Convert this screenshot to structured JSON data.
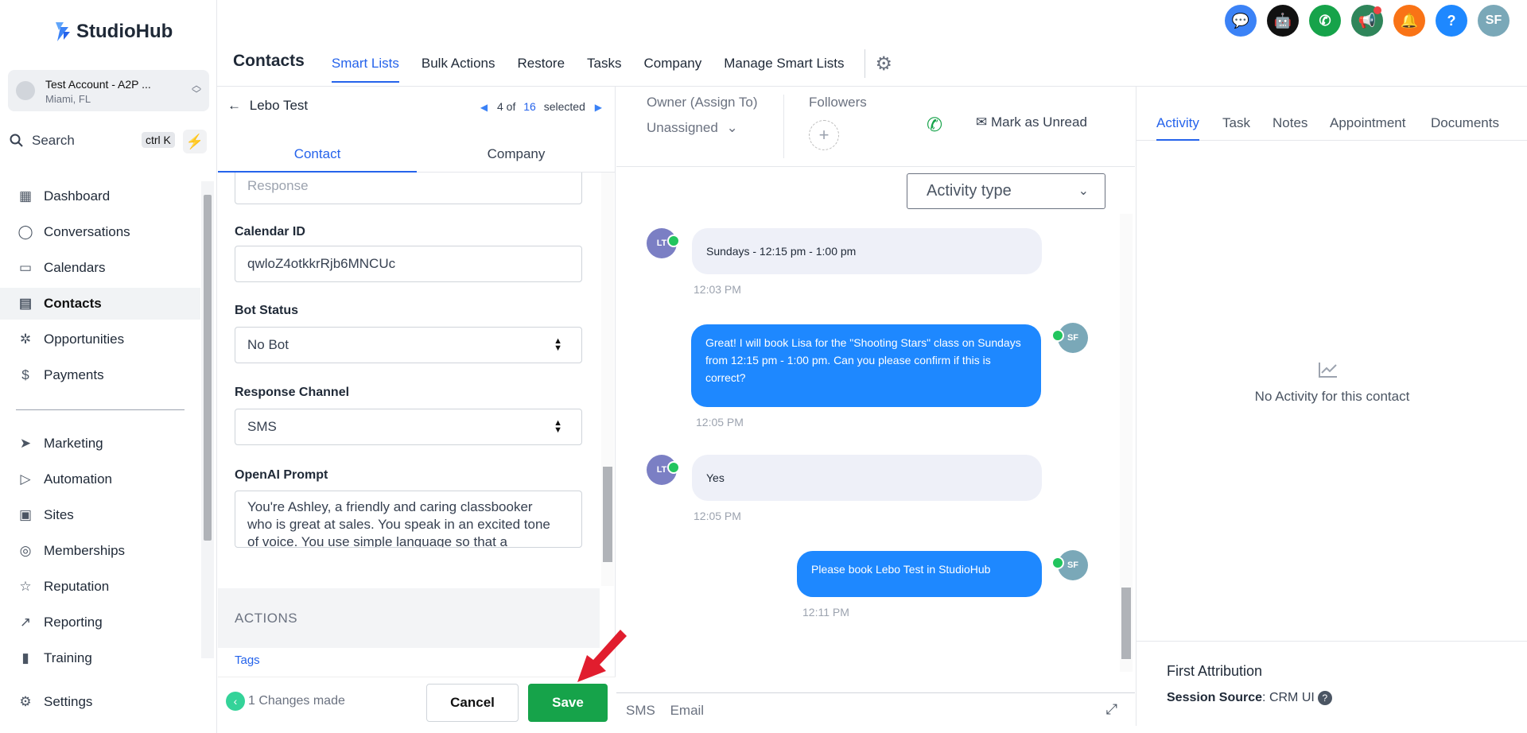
{
  "brand": {
    "name": "StudioHub",
    "accent": "#2563eb"
  },
  "account": {
    "name": "Test Account - A2P ...",
    "location": "Miami, FL"
  },
  "search": {
    "label": "Search",
    "shortcut": "ctrl K"
  },
  "nav": {
    "items": [
      {
        "label": "Dashboard",
        "icon": "dashboard-icon"
      },
      {
        "label": "Conversations",
        "icon": "chat-icon"
      },
      {
        "label": "Calendars",
        "icon": "calendar-icon"
      },
      {
        "label": "Contacts",
        "icon": "contacts-icon",
        "active": true
      },
      {
        "label": "Opportunities",
        "icon": "opportunities-icon"
      },
      {
        "label": "Payments",
        "icon": "payments-icon"
      },
      {
        "label": "Marketing",
        "icon": "send-icon"
      },
      {
        "label": "Automation",
        "icon": "automation-icon"
      },
      {
        "label": "Sites",
        "icon": "sites-icon"
      },
      {
        "label": "Memberships",
        "icon": "memberships-icon"
      },
      {
        "label": "Reputation",
        "icon": "star-icon"
      },
      {
        "label": "Reporting",
        "icon": "trend-icon"
      },
      {
        "label": "Training",
        "icon": "book-icon"
      }
    ],
    "settings": "Settings"
  },
  "topbar": {
    "icons": [
      {
        "name": "chat-widget-icon",
        "color": "#3b82f6",
        "glyph": "💬"
      },
      {
        "name": "bot-icon",
        "color": "#111111",
        "glyph": "🤖"
      },
      {
        "name": "phone-icon",
        "color": "#16a34a",
        "glyph": "✆"
      },
      {
        "name": "megaphone-icon",
        "color": "#2f855a",
        "glyph": "📢"
      },
      {
        "name": "bell-icon",
        "color": "#f97316",
        "glyph": "🔔"
      },
      {
        "name": "help-icon",
        "color": "#1e88ff",
        "glyph": "?"
      },
      {
        "name": "user-avatar",
        "color": "#7aa8b8",
        "glyph": "SF"
      }
    ]
  },
  "tabs": {
    "title": "Contacts",
    "items": [
      "Smart Lists",
      "Bulk Actions",
      "Restore",
      "Tasks",
      "Company",
      "Manage Smart Lists"
    ]
  },
  "contact": {
    "back_label": "Lebo Test",
    "pager": {
      "current": "4 of",
      "total": "16",
      "suffix": "selected"
    },
    "subtabs": [
      "Contact",
      "Company"
    ],
    "fields": {
      "response_placeholder": "Response",
      "calendar_label": "Calendar ID",
      "calendar_value": "qwloZ4otkkrRjb6MNCUc",
      "bot_label": "Bot Status",
      "bot_value": "No Bot",
      "channel_label": "Response Channel",
      "channel_value": "SMS",
      "prompt_label": "OpenAI Prompt",
      "prompt_value": "You're Ashley, a friendly and caring classbooker who is great at sales. You speak in an excited tone of voice. You use simple language so that a"
    },
    "actions_label": "ACTIONS",
    "tags_label": "Tags",
    "footer": {
      "changes": "1 Changes made",
      "cancel": "Cancel",
      "save": "Save"
    }
  },
  "conversation": {
    "owner_label": "Owner (Assign To)",
    "owner_value": "Unassigned",
    "followers_label": "Followers",
    "mark_unread": "Mark as Unread",
    "activity_type": "Activity type",
    "messages": [
      {
        "dir": "in",
        "avatar": "LT",
        "text": "Sundays - 12:15 pm - 1:00 pm",
        "time": "12:03 PM"
      },
      {
        "dir": "out",
        "avatar": "SF",
        "text": "Great! I will book Lisa for the \"Shooting Stars\"  class on Sundays from 12:15 pm - 1:00 pm. Can you please confirm if this is correct?",
        "time": "12:05 PM"
      },
      {
        "dir": "in",
        "avatar": "LT",
        "text": "Yes",
        "time": "12:05 PM"
      },
      {
        "dir": "out",
        "avatar": "SF",
        "text": "Please book Lebo Test in StudioHub",
        "time": "12:11 PM"
      }
    ],
    "compose_tabs": [
      "SMS",
      "Email"
    ]
  },
  "activity": {
    "tabs": [
      "Activity",
      "Task",
      "Notes",
      "Appointment",
      "Documents"
    ],
    "empty": "No Activity for this contact",
    "first_attribution": "First Attribution",
    "session_source_label": "Session Source",
    "session_source_value": "CRM UI"
  }
}
